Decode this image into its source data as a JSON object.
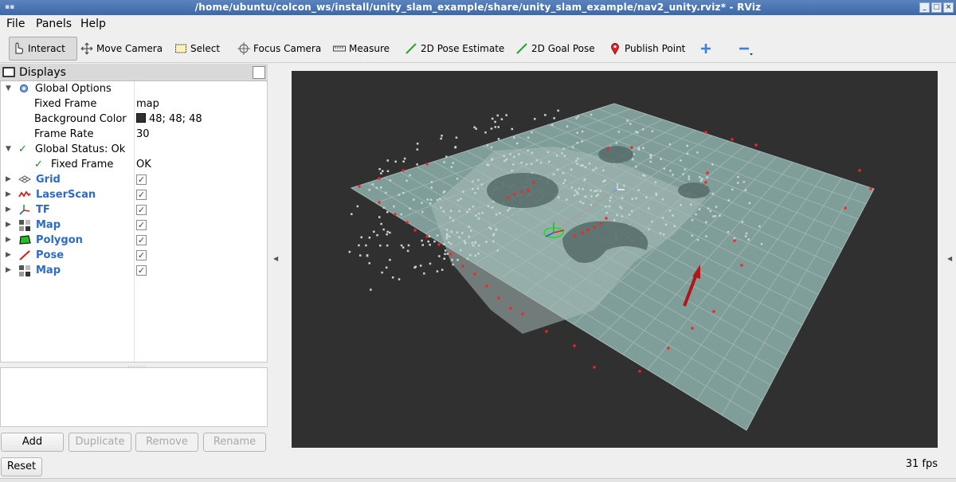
{
  "window": {
    "title": "/home/ubuntu/colcon_ws/install/unity_slam_example/share/unity_slam_example/nav2_unity.rviz* - RViz",
    "app_icon": "rviz-icon"
  },
  "menu": [
    {
      "label": "File"
    },
    {
      "label": "Panels"
    },
    {
      "label": "Help"
    }
  ],
  "toolbar": {
    "interact": "Interact",
    "move_camera": "Move Camera",
    "select": "Select",
    "focus_camera": "Focus Camera",
    "measure": "Measure",
    "pose_estimate": "2D Pose Estimate",
    "goal_pose": "2D Goal Pose",
    "publish_point": "Publish Point",
    "add_tool_icon": "plus-icon",
    "remove_tool_icon": "minus-icon"
  },
  "displays": {
    "title": "Displays",
    "global_options": {
      "label": "Global Options",
      "fixed_frame": {
        "label": "Fixed Frame",
        "value": "map"
      },
      "background_color": {
        "label": "Background Color",
        "value": "48; 48; 48",
        "color": "#303030"
      },
      "frame_rate": {
        "label": "Frame Rate",
        "value": "30"
      }
    },
    "global_status": {
      "label": "Global Status: Ok",
      "fixed_frame": {
        "label": "Fixed Frame",
        "value": "OK"
      }
    },
    "items": [
      {
        "label": "Grid",
        "checked": true,
        "icon": "grid-icon"
      },
      {
        "label": "LaserScan",
        "checked": true,
        "icon": "laserscan-icon"
      },
      {
        "label": "TF",
        "checked": true,
        "icon": "tf-icon"
      },
      {
        "label": "Map",
        "checked": true,
        "icon": "map-icon"
      },
      {
        "label": "Polygon",
        "checked": true,
        "icon": "polygon-icon"
      },
      {
        "label": "Pose",
        "checked": true,
        "icon": "pose-icon"
      },
      {
        "label": "Map",
        "checked": true,
        "icon": "map-icon"
      }
    ]
  },
  "buttons": {
    "add": "Add",
    "duplicate": "Duplicate",
    "remove": "Remove",
    "rename": "Rename",
    "reset": "Reset"
  },
  "status": {
    "fps": "31 fps"
  },
  "colors": {
    "background": "#303030",
    "map": "#7f9d99",
    "grid": "#a0a0a0",
    "laser": "#ff2020",
    "pose_arrow": "#b01818"
  }
}
